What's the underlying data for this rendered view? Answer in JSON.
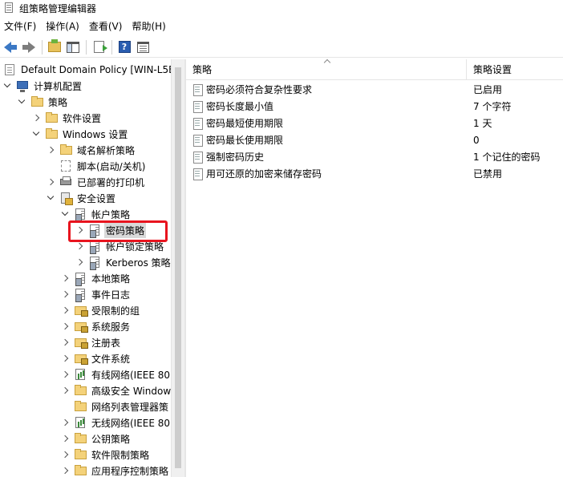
{
  "window": {
    "title": "组策略管理编辑器"
  },
  "menu": [
    "文件(F)",
    "操作(A)",
    "查看(V)",
    "帮助(H)"
  ],
  "toolbar": {
    "buttons": [
      "back-arrow",
      "forward-arrow",
      "up-folder",
      "show-hide-tree",
      "export-list",
      "help",
      "properties-grid"
    ]
  },
  "tree": [
    {
      "label": "Default Domain Policy [WIN-L5BI",
      "icon": "gpo-doc"
    },
    {
      "label": "计算机配置",
      "icon": "computer"
    },
    {
      "label": "策略",
      "icon": "folder"
    },
    {
      "label": "软件设置",
      "icon": "folder"
    },
    {
      "label": "Windows 设置",
      "icon": "folder"
    },
    {
      "label": "域名解析策略",
      "icon": "folder"
    },
    {
      "label": "脚本(启动/关机)",
      "icon": "script"
    },
    {
      "label": "已部署的打印机",
      "icon": "printer"
    },
    {
      "label": "安全设置",
      "icon": "security"
    },
    {
      "label": "帐户策略",
      "icon": "policy"
    },
    {
      "label": "密码策略",
      "icon": "policy"
    },
    {
      "label": "帐户锁定策略",
      "icon": "policy"
    },
    {
      "label": "Kerberos 策略",
      "icon": "policy"
    },
    {
      "label": "本地策略",
      "icon": "policy"
    },
    {
      "label": "事件日志",
      "icon": "policy"
    },
    {
      "label": "受限制的组",
      "icon": "locked-folder"
    },
    {
      "label": "系统服务",
      "icon": "locked-folder"
    },
    {
      "label": "注册表",
      "icon": "locked-folder"
    },
    {
      "label": "文件系统",
      "icon": "locked-folder"
    },
    {
      "label": "有线网络(IEEE 80",
      "icon": "network"
    },
    {
      "label": "高级安全 Window",
      "icon": "folder"
    },
    {
      "label": "网络列表管理器策",
      "icon": "folder"
    },
    {
      "label": "无线网络(IEEE 80",
      "icon": "network"
    },
    {
      "label": "公钥策略",
      "icon": "folder"
    },
    {
      "label": "软件限制策略",
      "icon": "folder"
    },
    {
      "label": "应用程序控制策略",
      "icon": "folder"
    }
  ],
  "selected_node": "密码策略",
  "detail": {
    "columns": [
      "策略",
      "策略设置"
    ],
    "rows": [
      {
        "policy": "密码必须符合复杂性要求",
        "setting": "已启用"
      },
      {
        "policy": "密码长度最小值",
        "setting": "7 个字符"
      },
      {
        "policy": "密码最短使用期限",
        "setting": "1 天"
      },
      {
        "policy": "密码最长使用期限",
        "setting": "0"
      },
      {
        "policy": "强制密码历史",
        "setting": "1 个记住的密码"
      },
      {
        "policy": "用可还原的加密来储存密码",
        "setting": "已禁用"
      }
    ]
  },
  "colors": {
    "highlight_border": "#e8141e",
    "selection_bg": "#d9d9d9"
  }
}
